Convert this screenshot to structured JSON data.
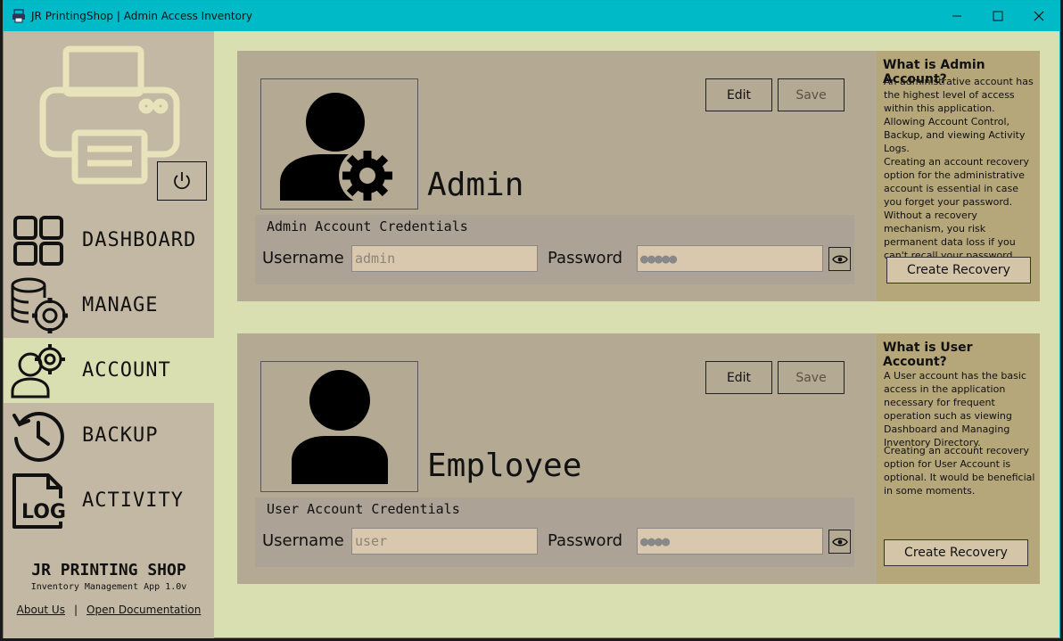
{
  "window": {
    "title": "JR PrintingShop | Admin Access Inventory"
  },
  "sidebar": {
    "items": [
      {
        "label": "DASHBOARD",
        "icon": "dashboard-grid-icon"
      },
      {
        "label": "MANAGE",
        "icon": "database-gear-icon"
      },
      {
        "label": "ACCOUNT",
        "icon": "user-gear-icon",
        "active": true
      },
      {
        "label": "BACKUP",
        "icon": "history-clock-icon"
      },
      {
        "label": "ACTIVITY",
        "icon": "log-file-icon"
      }
    ],
    "footer": {
      "shop_name": "JR PRINTING SHOP",
      "version": "Inventory Management App 1.0v",
      "about": "About Us",
      "separator": "|",
      "docs": "Open Documentation"
    }
  },
  "admin_card": {
    "name": "Admin",
    "edit_label": "Edit",
    "save_label": "Save",
    "credentials_title": "Admin Account Credentials",
    "username_label": "Username",
    "username_value": "admin",
    "password_label": "Password",
    "password_value": "●●●●●",
    "info_title": "What is Admin Account?",
    "info_p1": "An administrative account has the highest level of access within this application. Allowing Account Control, Backup, and viewing Activity Logs.",
    "info_p2": "Creating an account recovery option for the administrative account is essential in case you forget your password. Without a recovery mechanism, you risk permanent data loss if you can't recall your password.",
    "recovery_label": "Create Recovery"
  },
  "user_card": {
    "name": "Employee",
    "edit_label": "Edit",
    "save_label": "Save",
    "credentials_title": "User Account Credentials",
    "username_label": "Username",
    "username_value": "user",
    "password_label": "Password",
    "password_value": "●●●●",
    "info_title": "What is User Account?",
    "info_p1": "A User account has the basic access in the application necessary for frequent operation such as viewing Dashboard and Managing Inventory Directory.",
    "info_p2": "Creating an account recovery option for User Account is optional. It would be beneficial in some moments.",
    "recovery_label": "Create Recovery"
  },
  "colors": {
    "titlebar": "#00bac8",
    "background": "#dadfb2",
    "sidebar": "#c3b8a3",
    "card": "#b4a993",
    "info_panel": "#b5a77a"
  }
}
